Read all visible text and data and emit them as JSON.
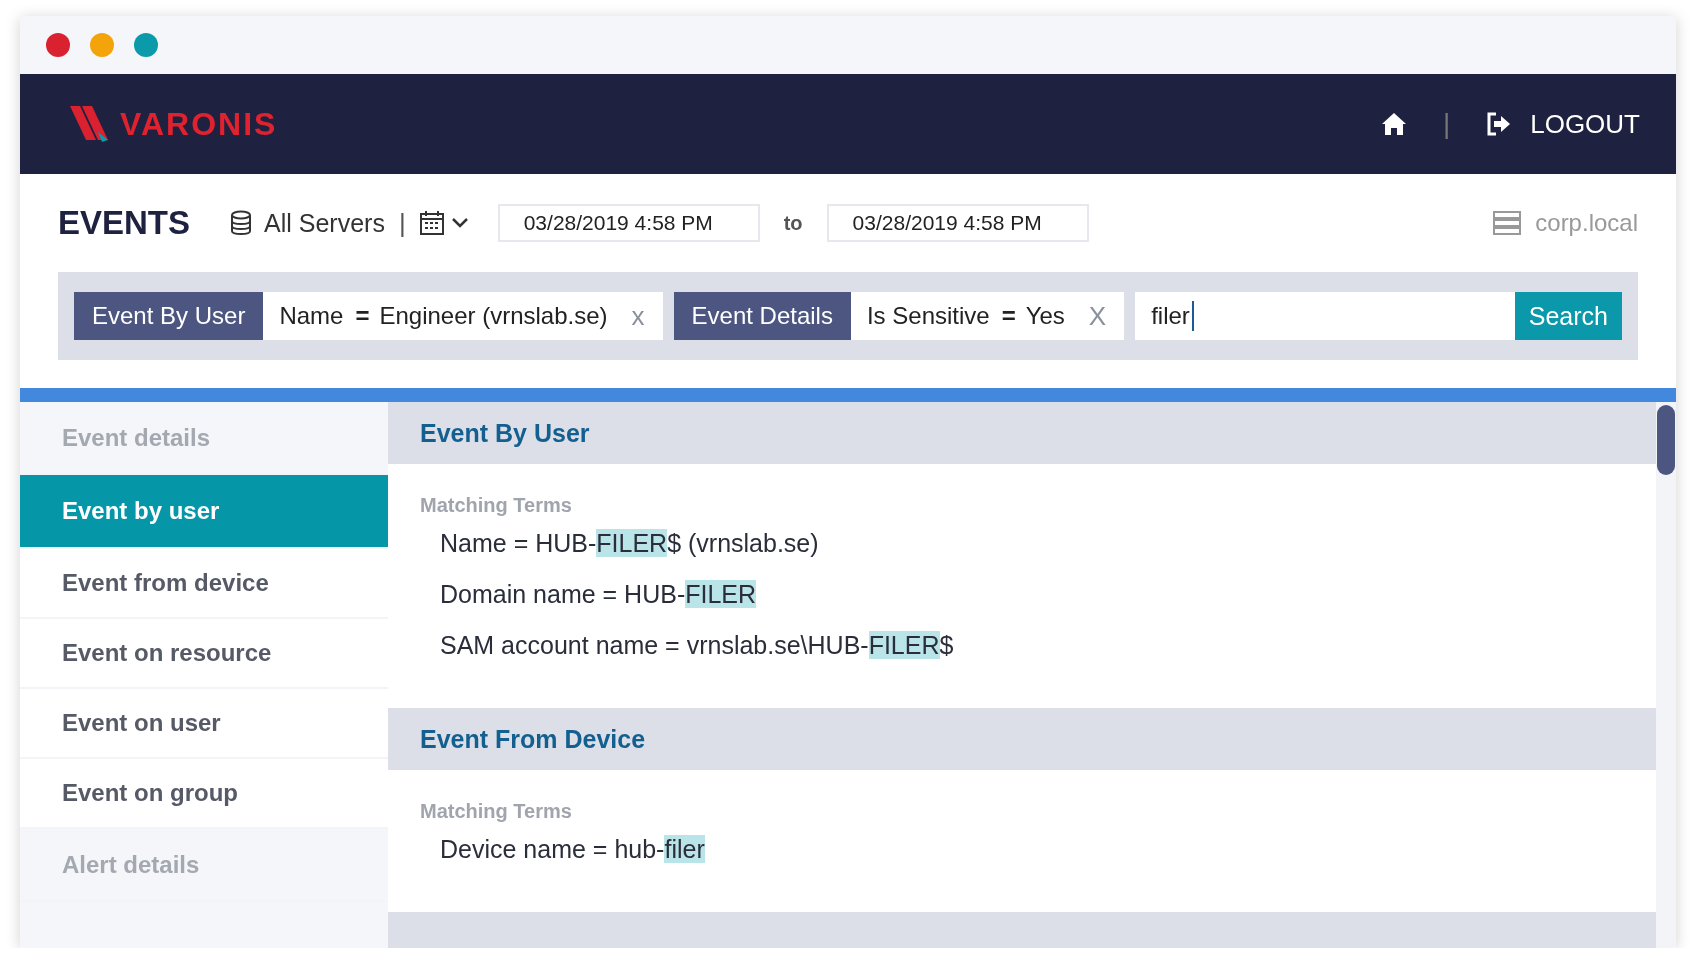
{
  "window": {
    "controls": [
      {
        "color": "#d9212f"
      },
      {
        "color": "#f3a40b"
      },
      {
        "color": "#0a9aaa"
      }
    ]
  },
  "header": {
    "logo": "VARONIS",
    "separator": "|",
    "logout": "LOGOUT"
  },
  "toolbar": {
    "title": "EVENTS",
    "servers": "All Servers",
    "separator": "|",
    "date_from": "03/28/2019 4:58 PM",
    "to": "to",
    "date_to": "03/28/2019 4:58 PM",
    "domain": "corp.local"
  },
  "filters": [
    {
      "category": "Event By User",
      "field": "Name",
      "operator": "=",
      "value": "Engineer (vrnslab.se)",
      "remove": "x"
    },
    {
      "category": "Event Details",
      "field": "Is Sensitive",
      "operator": "=",
      "value": "Yes",
      "remove": "X"
    }
  ],
  "search": {
    "value": "filer",
    "button": "Search"
  },
  "sidebar": {
    "items": [
      {
        "kind": "header",
        "label": "Event details",
        "selected": false
      },
      {
        "kind": "item",
        "label": "Event by user",
        "selected": true
      },
      {
        "kind": "item",
        "label": "Event from device",
        "selected": false
      },
      {
        "kind": "item",
        "label": "Event on resource",
        "selected": false
      },
      {
        "kind": "item",
        "label": "Event on user",
        "selected": false
      },
      {
        "kind": "item",
        "label": "Event on group",
        "selected": false
      },
      {
        "kind": "header",
        "label": "Alert details",
        "selected": false
      }
    ]
  },
  "sections": [
    {
      "title": "Event By User",
      "subtitle": "Matching Terms",
      "lines": [
        {
          "segments": [
            {
              "text": "Name = HUB-",
              "highlighted": false
            },
            {
              "text": "FILER",
              "highlighted": true
            },
            {
              "text": "$ (vrnslab.se)",
              "highlighted": false
            }
          ]
        },
        {
          "segments": [
            {
              "text": "Domain name = HUB-",
              "highlighted": false
            },
            {
              "text": "FILER",
              "highlighted": true
            }
          ]
        },
        {
          "segments": [
            {
              "text": "SAM account name = vrnslab.se\\HUB-",
              "highlighted": false
            },
            {
              "text": "FILER",
              "highlighted": true
            },
            {
              "text": "$",
              "highlighted": false
            }
          ]
        }
      ]
    },
    {
      "title": "Event From Device",
      "subtitle": "Matching Terms",
      "lines": [
        {
          "segments": [
            {
              "text": "Device name = hub-",
              "highlighted": false
            },
            {
              "text": "filer",
              "highlighted": true
            }
          ]
        }
      ]
    }
  ]
}
